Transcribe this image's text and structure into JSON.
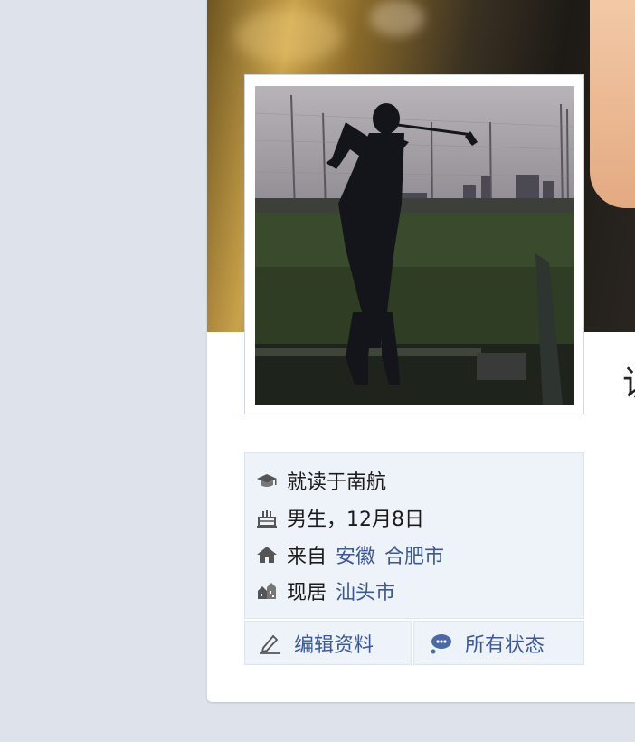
{
  "profile": {
    "name_partial": "访",
    "info": {
      "school": "就读于南航",
      "gender_birthday": "男生，12月8日",
      "hometown_prefix": "来自",
      "hometown_province": "安徽",
      "hometown_city": "合肥市",
      "current_prefix": "现居",
      "current_city": "汕头市"
    },
    "actions": {
      "edit_profile": "编辑资料",
      "all_status": "所有状态"
    }
  },
  "icons": {
    "school": "graduation-cap-icon",
    "birthday": "cake-icon",
    "hometown": "house-icon",
    "current": "buildings-icon",
    "edit": "pencil-icon",
    "status": "speech-bubble-icon"
  },
  "colors": {
    "background": "#dee2ea",
    "info_bg": "#eef2f9",
    "link": "#3b5998",
    "text": "#1c1c1c"
  }
}
